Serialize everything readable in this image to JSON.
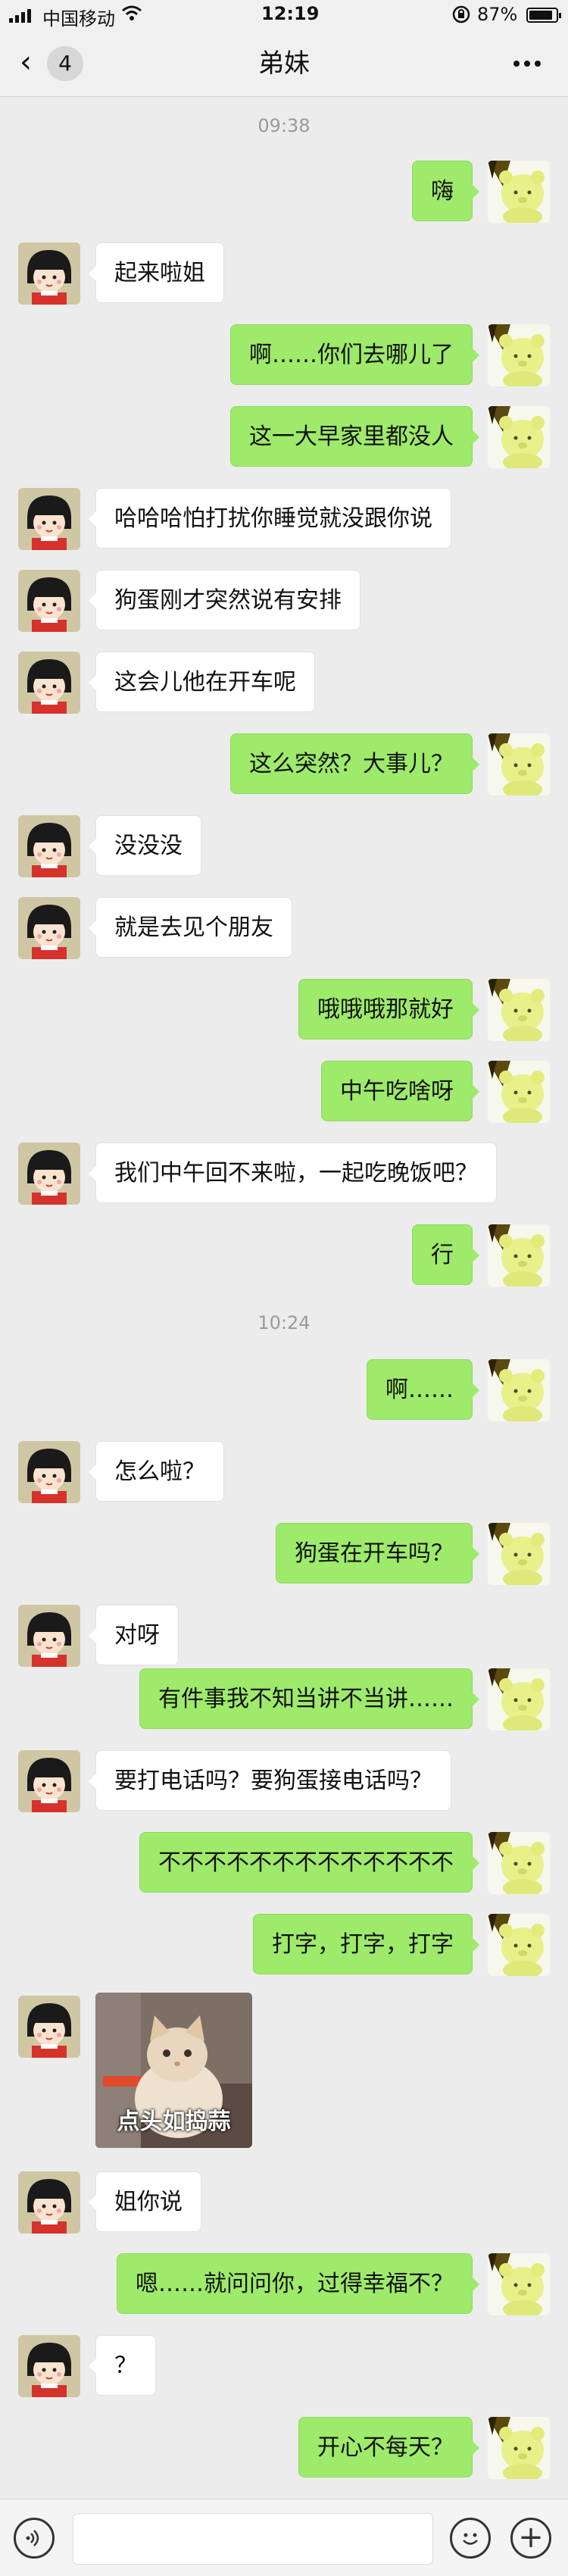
{
  "status_bar": {
    "carrier": "中国移动",
    "time": "12:19",
    "battery_percent": "87%",
    "battery_level": 0.87,
    "icons": [
      "signal-icon",
      "wifi-icon",
      "rotation-lock-icon",
      "battery-icon"
    ]
  },
  "nav": {
    "back_icon": "chevron-left-icon",
    "unread_count": "4",
    "title": "弟妹",
    "more_icon": "more-dots-icon"
  },
  "chat": {
    "timestamps": [
      "09:38",
      "10:24"
    ],
    "messages": [
      {
        "side": "right",
        "text": "嗨"
      },
      {
        "side": "left",
        "text": "起来啦姐"
      },
      {
        "side": "right",
        "text": "啊……你们去哪儿了"
      },
      {
        "side": "right",
        "text": "这一大早家里都没人"
      },
      {
        "side": "left",
        "text": "哈哈哈怕打扰你睡觉就没跟你说"
      },
      {
        "side": "left",
        "text": "狗蛋刚才突然说有安排"
      },
      {
        "side": "left",
        "text": "这会儿他在开车呢"
      },
      {
        "side": "right",
        "text": "这么突然？大事儿？"
      },
      {
        "side": "left",
        "text": "没没没"
      },
      {
        "side": "left",
        "text": "就是去见个朋友"
      },
      {
        "side": "right",
        "text": "哦哦哦那就好"
      },
      {
        "side": "right",
        "text": "中午吃啥呀"
      },
      {
        "side": "left",
        "text": "我们中午回不来啦，一起吃晚饭吧？"
      },
      {
        "side": "right",
        "text": "行"
      },
      {
        "side": "right",
        "text": "啊……"
      },
      {
        "side": "left",
        "text": "怎么啦？"
      },
      {
        "side": "right",
        "text": "狗蛋在开车吗？"
      },
      {
        "side": "left",
        "text": "对呀"
      },
      {
        "side": "right",
        "text": "有件事我不知当讲不当讲……"
      },
      {
        "side": "left",
        "text": "要打电话吗？要狗蛋接电话吗？"
      },
      {
        "side": "right",
        "text": "不不不不不不不不不不不不不"
      },
      {
        "side": "right",
        "text": "打字，打字，打字"
      },
      {
        "side": "left",
        "sticker": true,
        "text": "点头如捣蒜"
      },
      {
        "side": "left",
        "text": "姐你说"
      },
      {
        "side": "right",
        "text": "嗯……就问问你，过得幸福不？"
      },
      {
        "side": "left",
        "text": "？"
      },
      {
        "side": "right",
        "text": "开心不每天？"
      }
    ]
  },
  "input_bar": {
    "voice_icon": "voice-icon",
    "emoji_icon": "emoji-icon",
    "plus_icon": "plus-icon"
  },
  "colors": {
    "bubble_self": "#9eea6a",
    "bubble_other": "#ffffff",
    "background": "#ececec"
  }
}
